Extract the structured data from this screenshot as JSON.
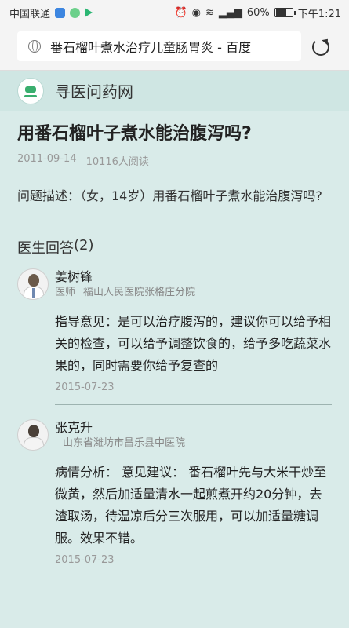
{
  "status_bar": {
    "carrier": "中国联通",
    "battery": "60%",
    "battery_level": 0.6,
    "time": "下午1:21"
  },
  "browser": {
    "url_title": "番石榴叶煮水治疗儿童肠胃炎 - 百度"
  },
  "site": {
    "name": "寻医问药网"
  },
  "question": {
    "title": "用番石榴叶子煮水能治腹泻吗?",
    "date": "2011-09-14",
    "views": "10116人阅读",
    "description": "问题描述：（女，14岁）用番石榴叶子煮水能治腹泻吗?"
  },
  "answers_header": {
    "label": "医生回答",
    "count": "(2)"
  },
  "answers": [
    {
      "name": "姜树锋",
      "title": "医师",
      "hospital": "福山人民医院张格庄分院",
      "text": "指导意见：是可以治疗腹泻的，建议你可以给予相关的检查，可以给予调整饮食的，给予多吃蔬菜水果的，同时需要你给予复查的",
      "date": "2015-07-23"
    },
    {
      "name": "张克升",
      "title": "",
      "hospital": "山东省潍坊市昌乐县中医院",
      "text": "病情分析： 意见建议： 番石榴叶先与大米干炒至微黄，然后加适量清水一起煎煮开约20分钟，去渣取汤，待温凉后分三次服用，可以加适量糖调服。效果不错。",
      "date": "2015-07-23"
    }
  ],
  "icons": {
    "globe": "globe-icon",
    "reload": "reload-icon",
    "logo": "site-logo-icon"
  }
}
